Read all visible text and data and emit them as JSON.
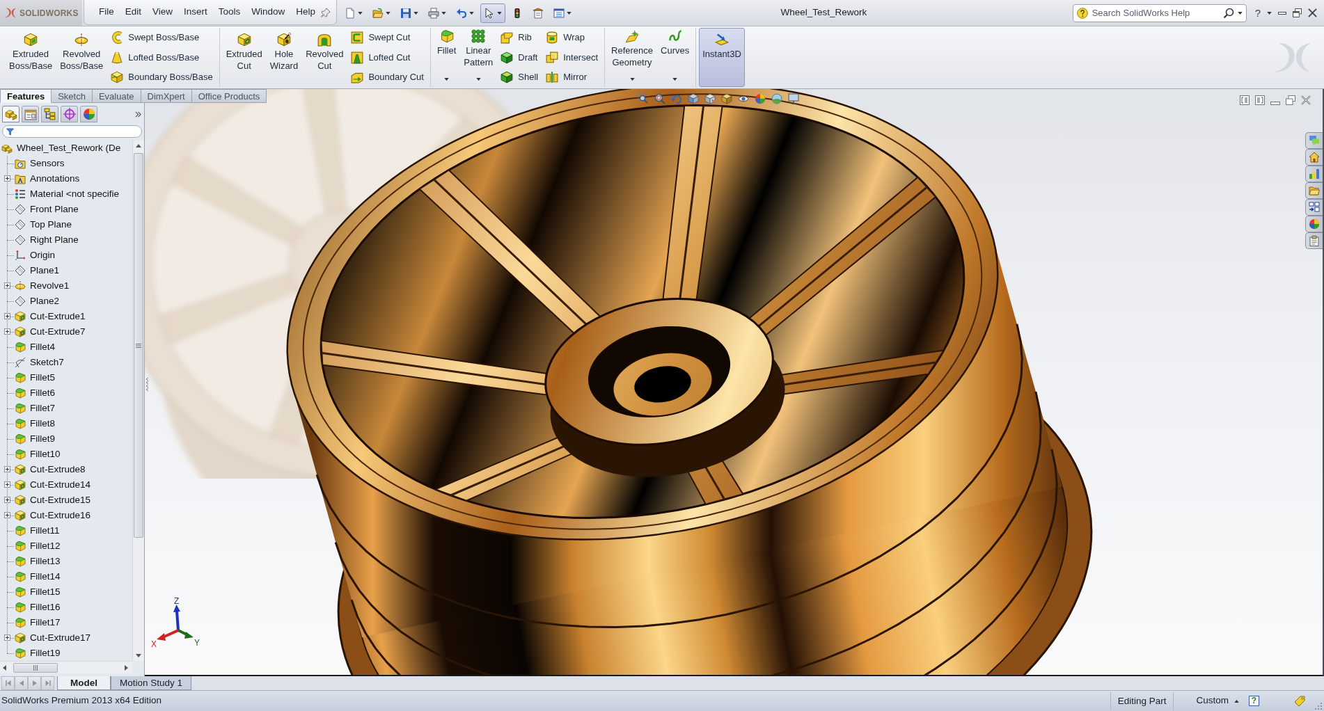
{
  "app": {
    "logo_text": "SOLIDWORKS"
  },
  "menu": [
    "File",
    "Edit",
    "View",
    "Insert",
    "Tools",
    "Window",
    "Help"
  ],
  "quick_access": [
    {
      "dropdown": true,
      "selected": false
    },
    {
      "dropdown": true,
      "selected": false
    },
    {
      "dropdown": true,
      "selected": false
    },
    {
      "dropdown": true,
      "selected": false
    },
    {
      "dropdown": true,
      "selected": false
    },
    {
      "dropdown": true,
      "selected": true
    },
    {
      "dropdown": false,
      "selected": false
    },
    {
      "dropdown": false,
      "selected": false
    },
    {
      "dropdown": true,
      "selected": false
    }
  ],
  "window": {
    "title": "Wheel_Test_Rework",
    "help": "?"
  },
  "search": {
    "placeholder": "Search SolidWorks Help"
  },
  "ribbon": {
    "groups": [
      {
        "columns": [
          {
            "kind": "large",
            "label": "Extruded Boss/Base",
            "dropdown": false,
            "selected": false
          },
          {
            "kind": "large",
            "label": "Revolved Boss/Base",
            "dropdown": false,
            "selected": false
          },
          {
            "kind": "stack",
            "items": [
              {
                "label": "Swept Boss/Base",
                "selected": false
              },
              {
                "label": "Lofted Boss/Base",
                "selected": false
              },
              {
                "label": "Boundary Boss/Base",
                "selected": false
              }
            ]
          }
        ]
      },
      {
        "columns": [
          {
            "kind": "large",
            "label": "Extruded Cut",
            "dropdown": false,
            "selected": false
          },
          {
            "kind": "large",
            "label": "Hole Wizard",
            "dropdown": false,
            "selected": false
          },
          {
            "kind": "large",
            "label": "Revolved Cut",
            "dropdown": false,
            "selected": false
          },
          {
            "kind": "stack",
            "items": [
              {
                "label": "Swept Cut",
                "selected": false
              },
              {
                "label": "Lofted Cut",
                "selected": false
              },
              {
                "label": "Boundary Cut",
                "selected": false
              }
            ]
          }
        ]
      },
      {
        "columns": [
          {
            "kind": "large",
            "label": "Fillet",
            "dropdown": true,
            "selected": false
          },
          {
            "kind": "large",
            "label": "Linear Pattern",
            "dropdown": true,
            "selected": false
          },
          {
            "kind": "stack",
            "items": [
              {
                "label": "Rib",
                "selected": false
              },
              {
                "label": "Draft",
                "selected": false
              },
              {
                "label": "Shell",
                "selected": false
              }
            ]
          },
          {
            "kind": "stack",
            "items": [
              {
                "label": "Wrap",
                "selected": false
              },
              {
                "label": "Intersect",
                "selected": false
              },
              {
                "label": "Mirror",
                "selected": false
              }
            ]
          }
        ]
      },
      {
        "columns": [
          {
            "kind": "large",
            "label": "Reference Geometry",
            "dropdown": true,
            "selected": false
          },
          {
            "kind": "large",
            "label": "Curves",
            "dropdown": true,
            "selected": false
          }
        ]
      },
      {
        "columns": [
          {
            "kind": "large",
            "label": "Instant3D",
            "dropdown": false,
            "selected": true
          }
        ]
      }
    ]
  },
  "command_tabs": [
    {
      "label": "Features",
      "selected": true
    },
    {
      "label": "Sketch",
      "selected": false
    },
    {
      "label": "Evaluate",
      "selected": false
    },
    {
      "label": "DimXpert",
      "selected": false
    },
    {
      "label": "Office Products",
      "selected": false
    }
  ],
  "manager_tabs": [
    {
      "selected": true
    },
    {
      "selected": false
    },
    {
      "selected": false
    },
    {
      "selected": false
    },
    {
      "selected": false
    }
  ],
  "feature_tree": {
    "label": "Wheel_Test_Rework (De",
    "kind": "part",
    "selected": false,
    "children": [
      {
        "label": "Sensors",
        "kind": "sensors",
        "expandable": false,
        "selected": false
      },
      {
        "label": "Annotations",
        "kind": "annotations",
        "expandable": true,
        "selected": false
      },
      {
        "label": "Material <not specifie",
        "kind": "material",
        "expandable": false,
        "selected": false
      },
      {
        "label": "Front Plane",
        "kind": "plane",
        "expandable": false,
        "selected": false
      },
      {
        "label": "Top Plane",
        "kind": "plane",
        "expandable": false,
        "selected": false
      },
      {
        "label": "Right Plane",
        "kind": "plane",
        "expandable": false,
        "selected": false
      },
      {
        "label": "Origin",
        "kind": "origin",
        "expandable": false,
        "selected": false
      },
      {
        "label": "Plane1",
        "kind": "plane",
        "expandable": false,
        "selected": false
      },
      {
        "label": "Revolve1",
        "kind": "revolve",
        "expandable": true,
        "selected": false
      },
      {
        "label": "Plane2",
        "kind": "plane",
        "expandable": false,
        "selected": false
      },
      {
        "label": "Cut-Extrude1",
        "kind": "cut-extrude",
        "expandable": true,
        "selected": false
      },
      {
        "label": "Cut-Extrude7",
        "kind": "cut-extrude",
        "expandable": true,
        "selected": false
      },
      {
        "label": "Fillet4",
        "kind": "fillet",
        "expandable": false,
        "selected": false
      },
      {
        "label": "Sketch7",
        "kind": "sketch",
        "expandable": false,
        "selected": false
      },
      {
        "label": "Fillet5",
        "kind": "fillet",
        "expandable": false,
        "selected": false
      },
      {
        "label": "Fillet6",
        "kind": "fillet",
        "expandable": false,
        "selected": false
      },
      {
        "label": "Fillet7",
        "kind": "fillet",
        "expandable": false,
        "selected": false
      },
      {
        "label": "Fillet8",
        "kind": "fillet",
        "expandable": false,
        "selected": false
      },
      {
        "label": "Fillet9",
        "kind": "fillet",
        "expandable": false,
        "selected": false
      },
      {
        "label": "Fillet10",
        "kind": "fillet",
        "expandable": false,
        "selected": false
      },
      {
        "label": "Cut-Extrude8",
        "kind": "cut-extrude",
        "expandable": true,
        "selected": false
      },
      {
        "label": "Cut-Extrude14",
        "kind": "cut-extrude",
        "expandable": true,
        "selected": false
      },
      {
        "label": "Cut-Extrude15",
        "kind": "cut-extrude",
        "expandable": true,
        "selected": false
      },
      {
        "label": "Cut-Extrude16",
        "kind": "cut-extrude",
        "expandable": true,
        "selected": false
      },
      {
        "label": "Fillet11",
        "kind": "fillet",
        "expandable": false,
        "selected": false
      },
      {
        "label": "Fillet12",
        "kind": "fillet",
        "expandable": false,
        "selected": false
      },
      {
        "label": "Fillet13",
        "kind": "fillet",
        "expandable": false,
        "selected": false
      },
      {
        "label": "Fillet14",
        "kind": "fillet",
        "expandable": false,
        "selected": false
      },
      {
        "label": "Fillet15",
        "kind": "fillet",
        "expandable": false,
        "selected": false
      },
      {
        "label": "Fillet16",
        "kind": "fillet",
        "expandable": false,
        "selected": false
      },
      {
        "label": "Fillet17",
        "kind": "fillet",
        "expandable": false,
        "selected": false
      },
      {
        "label": "Cut-Extrude17",
        "kind": "cut-extrude",
        "expandable": true,
        "selected": false
      },
      {
        "label": "Fillet19",
        "kind": "fillet",
        "expandable": false,
        "selected": false
      }
    ]
  },
  "viewport": {
    "triad": {
      "x": "X",
      "y": "Y",
      "z": "Z"
    }
  },
  "bottom_tabs": [
    {
      "label": "Model",
      "selected": true
    },
    {
      "label": "Motion Study 1",
      "selected": false
    }
  ],
  "status_bar": {
    "edition": "SolidWorks Premium 2013 x64 Edition",
    "mode": "Editing Part",
    "units": "Custom",
    "help": "?"
  }
}
